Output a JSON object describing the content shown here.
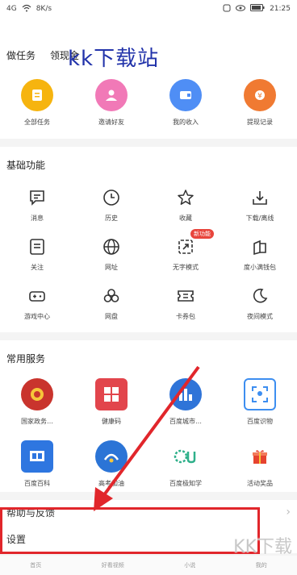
{
  "status": {
    "carrier": "4G",
    "net": "8K/s",
    "time": "21:25"
  },
  "watermark_top": "kk下载站",
  "tabs": [
    "做任务",
    "领现金"
  ],
  "task_items": [
    {
      "label": "全部任务",
      "icon": "task-list-icon",
      "color": "#f6b40f"
    },
    {
      "label": "邀请好友",
      "icon": "invite-friend-icon",
      "color": "#f179b7"
    },
    {
      "label": "我的收入",
      "icon": "wallet-icon",
      "color": "#4f8ef5"
    },
    {
      "label": "提现记录",
      "icon": "cash-record-icon",
      "color": "#f07a32"
    }
  ],
  "basic_title": "基础功能",
  "basic_items": [
    {
      "label": "消息",
      "icon": "message-icon"
    },
    {
      "label": "历史",
      "icon": "clock-icon"
    },
    {
      "label": "收藏",
      "icon": "star-icon"
    },
    {
      "label": "下载/离线",
      "icon": "download-icon"
    },
    {
      "label": "关注",
      "icon": "follow-icon"
    },
    {
      "label": "网址",
      "icon": "globe-icon"
    },
    {
      "label": "无字模式",
      "icon": "no-image-icon",
      "badge": "新功能"
    },
    {
      "label": "度小满钱包",
      "icon": "wallet-outline-icon"
    },
    {
      "label": "游戏中心",
      "icon": "gamepad-icon"
    },
    {
      "label": "网盘",
      "icon": "cloud-disk-icon"
    },
    {
      "label": "卡券包",
      "icon": "ticket-icon"
    },
    {
      "label": "夜间模式",
      "icon": "moon-icon"
    }
  ],
  "common_title": "常用服务",
  "common_items": [
    {
      "label": "国家政务…",
      "icon": "emblem-icon",
      "color": "#c9342d"
    },
    {
      "label": "健康码",
      "icon": "health-code-icon",
      "color": "#e2454c"
    },
    {
      "label": "百度城市…",
      "icon": "city-service-icon",
      "color": "#2f74d8"
    },
    {
      "label": "百度识物",
      "icon": "scan-icon",
      "color": "#3d8ef0"
    },
    {
      "label": "百度百科",
      "icon": "baike-icon",
      "color": "#2e76e0"
    },
    {
      "label": "高考加油",
      "icon": "exam-icon",
      "color": "#2b74d6"
    },
    {
      "label": "百度极知学",
      "icon": "study-icon",
      "color": "#2fb08a"
    },
    {
      "label": "活动奖品",
      "icon": "gift-icon",
      "color": "#e6432f"
    }
  ],
  "help": {
    "label": "帮助与反馈",
    "chevron": "›"
  },
  "settings": {
    "label": "设置"
  },
  "bottom_nav": [
    "首页",
    "好看视频",
    "小说",
    "我的"
  ],
  "watermark_corner": "KK下载"
}
